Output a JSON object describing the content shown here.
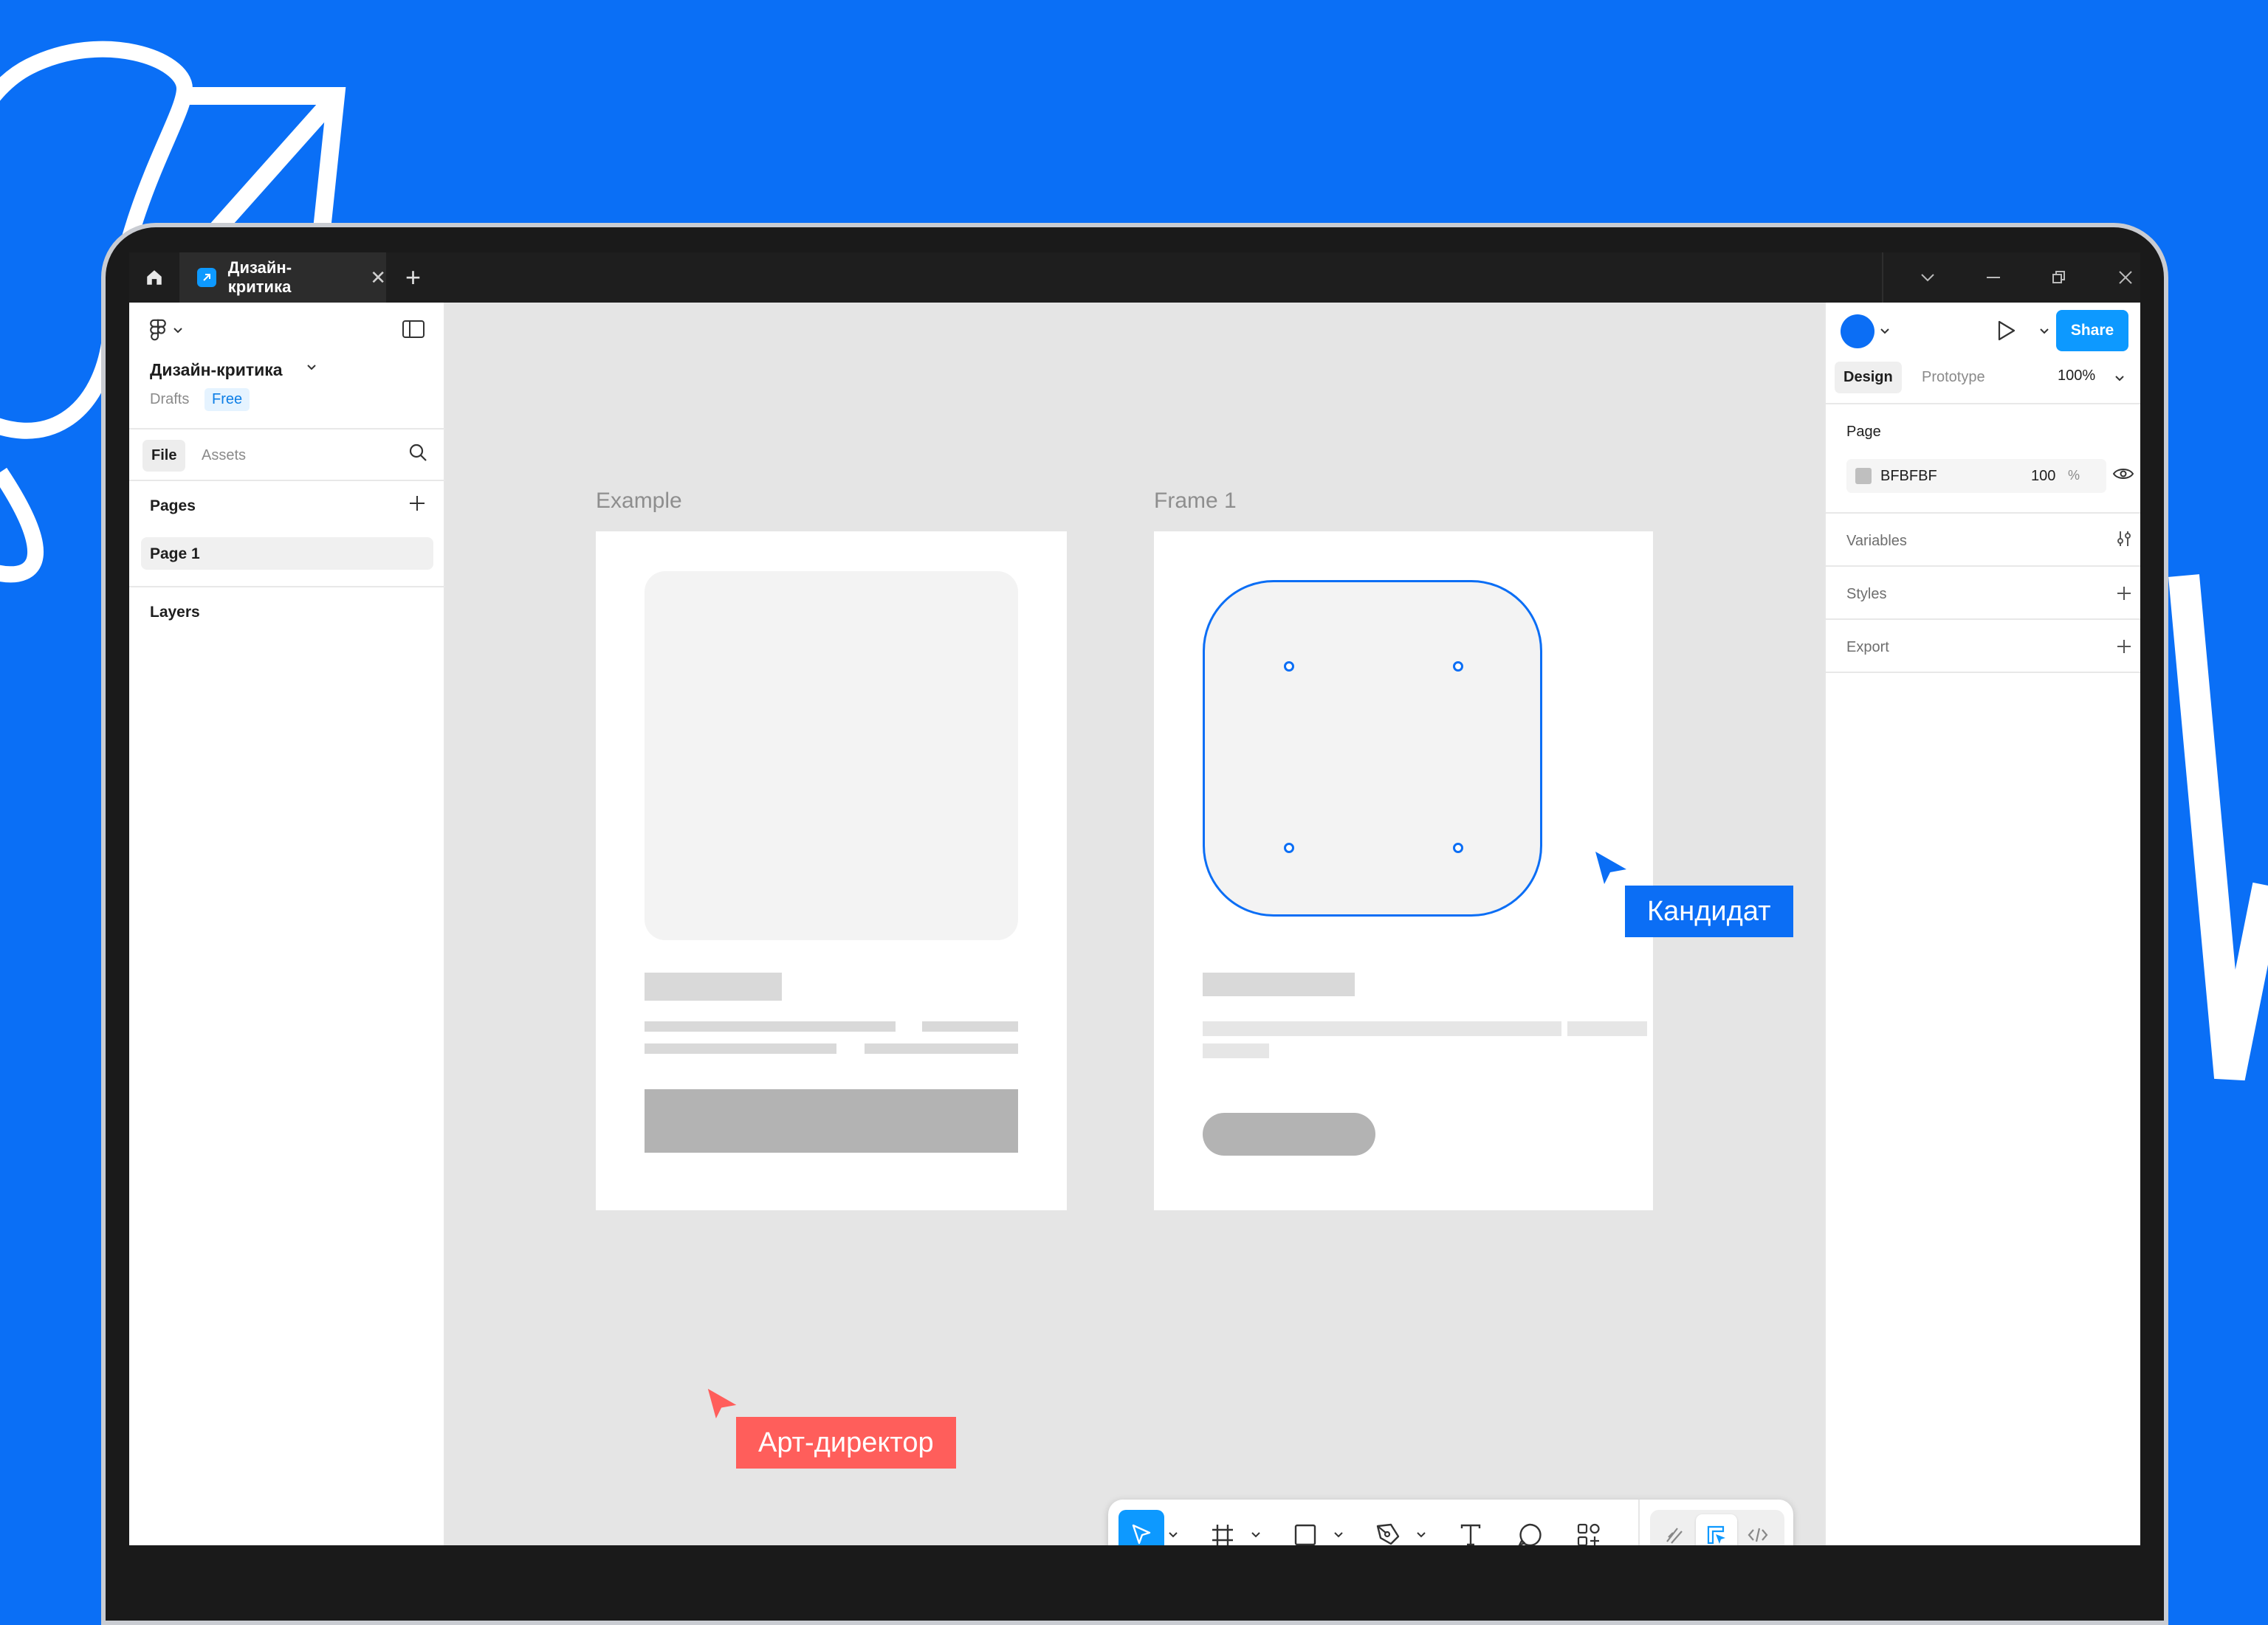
{
  "titlebar": {
    "home_icon": "home-icon",
    "tab_title": "Дизайн-критика",
    "tab_close": "✕",
    "new_tab": "+"
  },
  "left_panel": {
    "file_title": "Дизайн-критика",
    "location": "Drafts",
    "plan_badge": "Free",
    "tabs": [
      "File",
      "Assets"
    ],
    "pages_heading": "Pages",
    "pages": [
      "Page 1"
    ],
    "layers_heading": "Layers"
  },
  "right_panel": {
    "share_label": "Share",
    "tabs": [
      "Design",
      "Prototype"
    ],
    "zoom": "100%",
    "page_heading": "Page",
    "page_color_hex": "BFBFBF",
    "page_opacity": "100",
    "page_opacity_unit": "%",
    "sections": [
      "Variables",
      "Styles",
      "Export"
    ]
  },
  "canvas": {
    "frames": [
      {
        "label": "Example"
      },
      {
        "label": "Frame 1"
      }
    ],
    "cursor_candidate": "Кандидат",
    "cursor_art_director": "Арт-директор"
  },
  "toolbar": {
    "tools": [
      "move-icon",
      "frame-icon",
      "rectangle-icon",
      "pen-icon",
      "text-icon",
      "comment-icon",
      "actions-icon"
    ],
    "modes": [
      "draw-mode-icon",
      "design-mode-icon",
      "dev-mode-icon"
    ]
  },
  "colors": {
    "background": "#0a6ff6",
    "accent": "#0d99ff",
    "selection": "#0b6ef5",
    "art_director": "#ff5e5b"
  }
}
